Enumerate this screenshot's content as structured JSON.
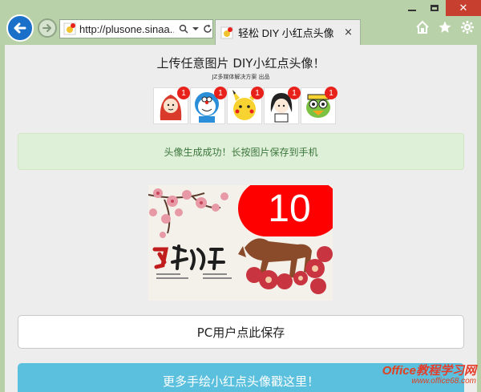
{
  "browser": {
    "url": "http://plusone.sinaa...",
    "tab_title": "轻松 DIY 小红点头像",
    "tab_close": "×"
  },
  "page": {
    "headline": "上传任意图片 DIY小红点头像！",
    "subline": "JZ多媒体解决方案 出品",
    "avatar_badges": [
      "1",
      "1",
      "1",
      "1",
      "1"
    ],
    "alert_text": "头像生成成功！长按图片保存到手机",
    "preview_badge": "10",
    "save_button": "PC用户点此保存",
    "more_button": "更多手绘小红点头像戳这里！"
  },
  "watermark": {
    "top_latin": "Office",
    "top_cn": "教程学习网",
    "bottom": "www.office68.com"
  },
  "colors": {
    "accent_blue": "#1a6fc9",
    "badge_red": "#e8211b",
    "alert_bg": "#dff0d8",
    "alert_text": "#3c763d",
    "info_button": "#5bc0de",
    "frame": "#b9d1a9"
  },
  "icons": {
    "back": "arrow-left-icon",
    "forward": "arrow-right-icon",
    "search": "search-icon",
    "refresh": "refresh-icon",
    "home": "home-icon",
    "favorites": "star-icon",
    "settings": "gear-icon"
  }
}
